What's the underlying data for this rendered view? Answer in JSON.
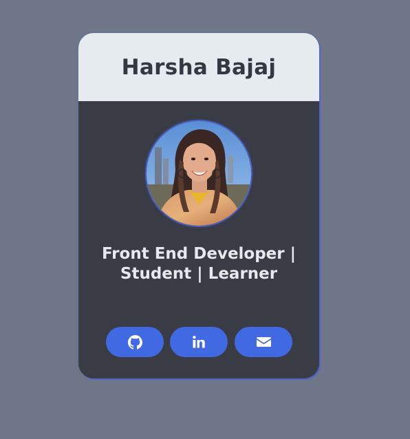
{
  "profile": {
    "name": "Harsha Bajaj",
    "tagline": "Front End Developer | Student | Learner",
    "avatar_alt": "Profile photo of Harsha Bajaj"
  },
  "social_links": [
    {
      "name": "github",
      "icon": "github-icon"
    },
    {
      "name": "linkedin",
      "icon": "linkedin-icon"
    },
    {
      "name": "email",
      "icon": "envelope-icon"
    }
  ],
  "colors": {
    "background": "#6f7789",
    "card": "#393b45",
    "header": "#e6ebef",
    "accent": "#4169e1",
    "name_text": "#343842",
    "tagline_text": "#e7e9ee"
  }
}
